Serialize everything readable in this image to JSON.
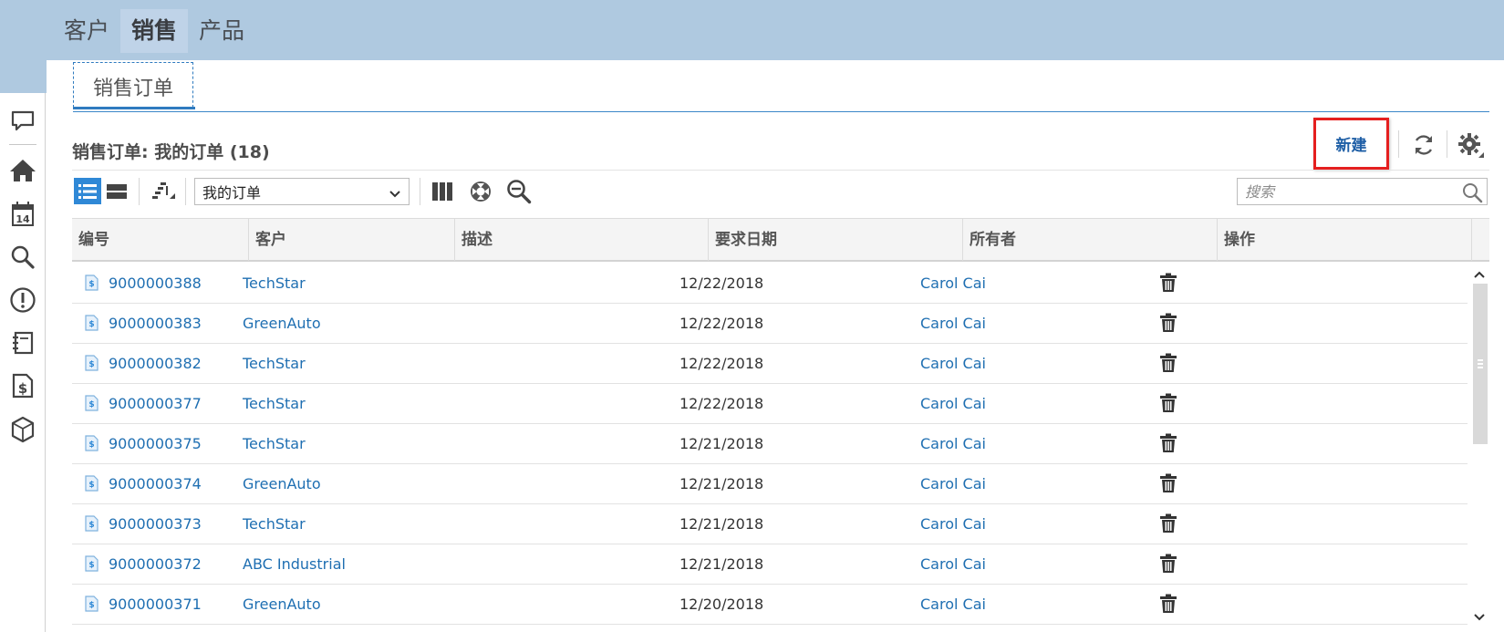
{
  "top_nav": {
    "tabs": [
      {
        "label": "客户",
        "active": false
      },
      {
        "label": "销售",
        "active": true
      },
      {
        "label": "产品",
        "active": false
      }
    ]
  },
  "left_rail": {
    "icons": [
      "chat-bubble-icon",
      "home-icon",
      "calendar-icon",
      "search-icon",
      "alert-icon",
      "notebook-icon",
      "dollar-document-icon",
      "product-box-icon"
    ],
    "calendar_day": "14"
  },
  "subtab": {
    "label": "销售订单"
  },
  "section": {
    "title": "销售订单: 我的订单 (18)"
  },
  "actions": {
    "new_label": "新建"
  },
  "toolbar": {
    "view_selected": "我的订单",
    "search_placeholder": "搜索"
  },
  "table": {
    "columns": [
      "编号",
      "客户",
      "描述",
      "要求日期",
      "所有者",
      "操作"
    ],
    "rows": [
      {
        "id": "9000000388",
        "customer": "TechStar",
        "description": "",
        "date": "12/22/2018",
        "owner": "Carol Cai"
      },
      {
        "id": "9000000383",
        "customer": "GreenAuto",
        "description": "",
        "date": "12/22/2018",
        "owner": "Carol Cai"
      },
      {
        "id": "9000000382",
        "customer": "TechStar",
        "description": "",
        "date": "12/22/2018",
        "owner": "Carol Cai"
      },
      {
        "id": "9000000377",
        "customer": "TechStar",
        "description": "",
        "date": "12/22/2018",
        "owner": "Carol Cai"
      },
      {
        "id": "9000000375",
        "customer": "TechStar",
        "description": "",
        "date": "12/21/2018",
        "owner": "Carol Cai"
      },
      {
        "id": "9000000374",
        "customer": "GreenAuto",
        "description": "",
        "date": "12/21/2018",
        "owner": "Carol Cai"
      },
      {
        "id": "9000000373",
        "customer": "TechStar",
        "description": "",
        "date": "12/21/2018",
        "owner": "Carol Cai"
      },
      {
        "id": "9000000372",
        "customer": "ABC Industrial",
        "description": "",
        "date": "12/21/2018",
        "owner": "Carol Cai"
      },
      {
        "id": "9000000371",
        "customer": "GreenAuto",
        "description": "",
        "date": "12/20/2018",
        "owner": "Carol Cai"
      }
    ]
  },
  "colors": {
    "header_bg": "#afc9e0",
    "accent": "#2f88d6",
    "link": "#1f6fb2",
    "highlight_border": "#e51f1f"
  }
}
